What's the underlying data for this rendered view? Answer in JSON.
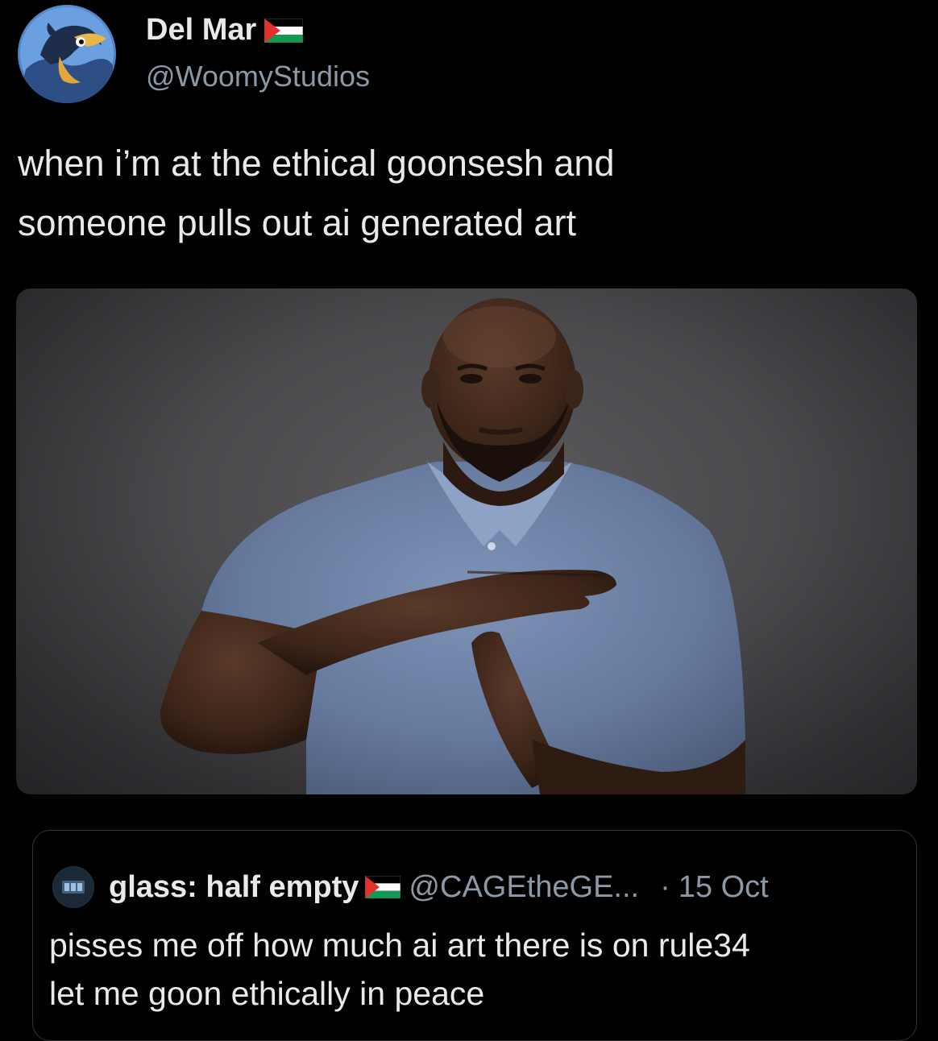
{
  "post": {
    "author": {
      "display_name": "Del Mar",
      "handle": "@WoomyStudios",
      "avatar_icon": "cartoon-bird-avatar",
      "flag_icon": "palestine-flag-icon"
    },
    "text_lines": [
      "when i’m at the ethical goonsesh and",
      "someone pulls out ai generated art"
    ],
    "media": {
      "icon": "photo-man-timeout-gesture"
    }
  },
  "quote": {
    "author": {
      "display_name": "glass: half empty",
      "handle": "@CAGEtheGE...",
      "avatar_icon": "dark-logo-avatar",
      "flag_icon": "palestine-flag-icon"
    },
    "separator": "·",
    "time": "15 Oct",
    "text_lines": [
      "pisses me off how much ai art there is on rule34",
      "let me goon ethically in peace"
    ]
  },
  "colors": {
    "background": "#000000",
    "text_primary": "#e7e9ea",
    "text_secondary": "#8b98a5",
    "border": "#2f3336",
    "flag_black": "#000000",
    "flag_white": "#ffffff",
    "flag_green": "#149954",
    "flag_red": "#e4312b"
  }
}
